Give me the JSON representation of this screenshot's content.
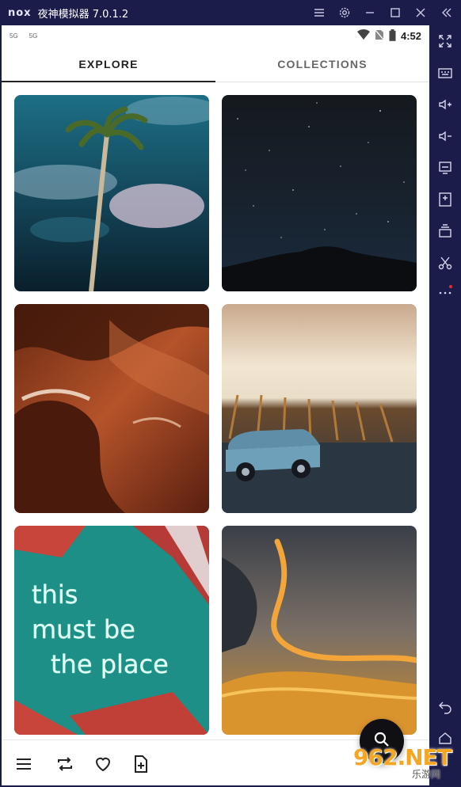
{
  "emulator": {
    "logo": "nox",
    "title": "夜神模拟器 7.0.1.2",
    "controls": [
      "menu-icon",
      "settings-icon",
      "minimize-icon",
      "maximize-icon",
      "close-icon",
      "collapse-icon"
    ],
    "side_tools": [
      "fullscreen-icon",
      "keyboard-icon",
      "volume-up-icon",
      "volume-down-icon",
      "screen-icon",
      "apk-icon",
      "multi-instance-icon",
      "cut-icon",
      "more-icon",
      "back-icon",
      "home-icon"
    ]
  },
  "status_bar": {
    "sim1": "5G",
    "sim2": "5G",
    "time": "4:52"
  },
  "tabs": [
    {
      "label": "EXPLORE",
      "active": true
    },
    {
      "label": "COLLECTIONS",
      "active": false
    }
  ],
  "photos": [
    {
      "subject": "Palm tree against cloudy night sky"
    },
    {
      "subject": "Starry sky over dark mountain ridge"
    },
    {
      "subject": "Orange sandstone slot canyon"
    },
    {
      "subject": "Vintage car under modern building"
    },
    {
      "subject": "Neon sign on teal wall",
      "sign_text": [
        "this",
        "must be",
        "the place"
      ]
    },
    {
      "subject": "Golden sand dunes"
    }
  ],
  "bottom_nav": [
    "menu-icon",
    "shuffle-icon",
    "heart-icon",
    "add-file-icon"
  ],
  "fab": {
    "icon": "search-icon"
  },
  "watermark": {
    "main": "962.NET",
    "sub": "乐游网"
  }
}
